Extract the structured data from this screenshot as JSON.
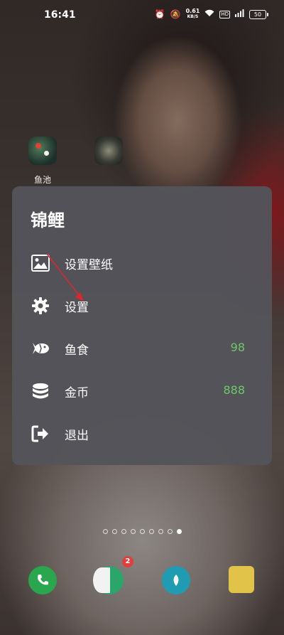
{
  "status_bar": {
    "time": "16:41",
    "network_speed_value": "0.61",
    "network_speed_unit": "KB/S",
    "hd_label": "HD",
    "battery": "50"
  },
  "home": {
    "apps": [
      {
        "label": "鱼池",
        "icon": "fish-pond-icon"
      },
      {
        "label": "",
        "icon": "app-icon"
      }
    ],
    "page_count": 9,
    "active_page": 9,
    "dock": [
      {
        "icon": "phone-icon"
      },
      {
        "icon": "messages-icon",
        "badge": "2"
      },
      {
        "icon": "browser-icon"
      },
      {
        "icon": "store-icon"
      }
    ]
  },
  "menu": {
    "title": "锦鲤",
    "items": [
      {
        "icon": "image-icon",
        "label": "设置壁纸",
        "value": ""
      },
      {
        "icon": "gear-icon",
        "label": "设置",
        "value": ""
      },
      {
        "icon": "fish-icon",
        "label": "鱼食",
        "value": "98"
      },
      {
        "icon": "coins-icon",
        "label": "金币",
        "value": "888"
      },
      {
        "icon": "exit-icon",
        "label": "退出",
        "value": ""
      }
    ]
  },
  "colors": {
    "menu_bg": "#54545a",
    "value_green": "#6dc86a",
    "annotation_red": "#e0262a"
  }
}
